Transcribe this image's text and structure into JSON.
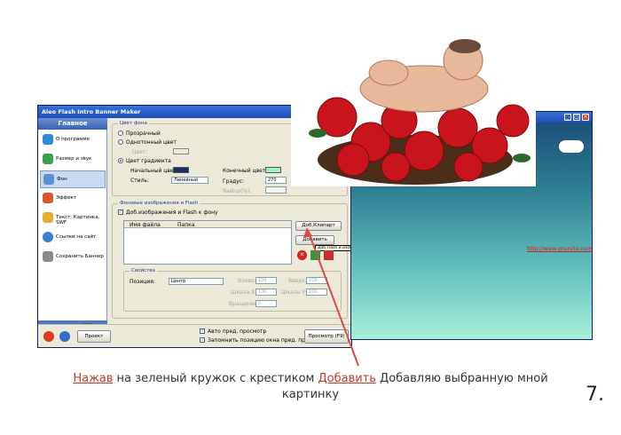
{
  "window": {
    "title": "Aleo Flash Intro Banner Maker",
    "sidebar_header": "Главное",
    "sidebar_items": [
      {
        "label": "О программе",
        "icon": "info-icon"
      },
      {
        "label": "Размер и звук",
        "icon": "resize-icon"
      },
      {
        "label": "Фон",
        "icon": "background-icon"
      },
      {
        "label": "Эффект",
        "icon": "effect-icon"
      },
      {
        "label": "Текст, Картинка, SWF",
        "icon": "text-image-icon"
      },
      {
        "label": "Ссылки на сайт",
        "icon": "globe-icon"
      },
      {
        "label": "Сохранить Баннер",
        "icon": "save-icon"
      }
    ],
    "bg_color": {
      "group_title": "Цвет фона",
      "transparent": "Прозрачный",
      "solid": "Однотонный цвет",
      "color_label": "Цвет:",
      "gradient": "Цвет градиента",
      "start_color": "Начальный цвет:",
      "end_color": "Конечный цвет:",
      "style_label": "Стиль:",
      "style_value": "Линейный",
      "degrees_label": "Градус:",
      "degrees_value": "270",
      "radius_label": "Radius(%):",
      "start_hex": "#16325c",
      "end_hex": "#9ef0c8"
    },
    "bg_images": {
      "group_title": "Фоновые изображения и Flash",
      "add_checkbox": "Доб.изображения и Flash к фону",
      "col_file": "Имя файла",
      "col_folder": "Папка",
      "btn_clipart": "Доб.Клипарт",
      "btn_add": "Добавить",
      "tooltip": "Доб.Flash и изображение"
    },
    "props": {
      "group_title": "Свойства",
      "position_label": "Позиция:",
      "position_value": "Центр",
      "left": "Влево:",
      "top": "Вверх:",
      "scale_x": "Шкала X:",
      "scale_y": "Шкала Y:",
      "rotate": "Вращение:",
      "v100a": "100",
      "v100b": "100",
      "v100c": "100",
      "v100d": "100",
      "v0": "0"
    },
    "bottom": {
      "project_btn": "Проект",
      "auto_preview": "Авто пред. просмотр",
      "remember_pos": "Запомнить позицию окна пред. просмотра",
      "preview_btn": "Просмотр (F9)"
    }
  },
  "preview": {
    "link": "http://www.yoursite.com"
  },
  "caption": {
    "word1": "Нажав",
    "text1": " на зеленый кружок с крестиком ",
    "word2": "Добавить",
    "text2": "  Добавляю выбранную мной",
    "line2": "картинку"
  },
  "slide_number": "7."
}
